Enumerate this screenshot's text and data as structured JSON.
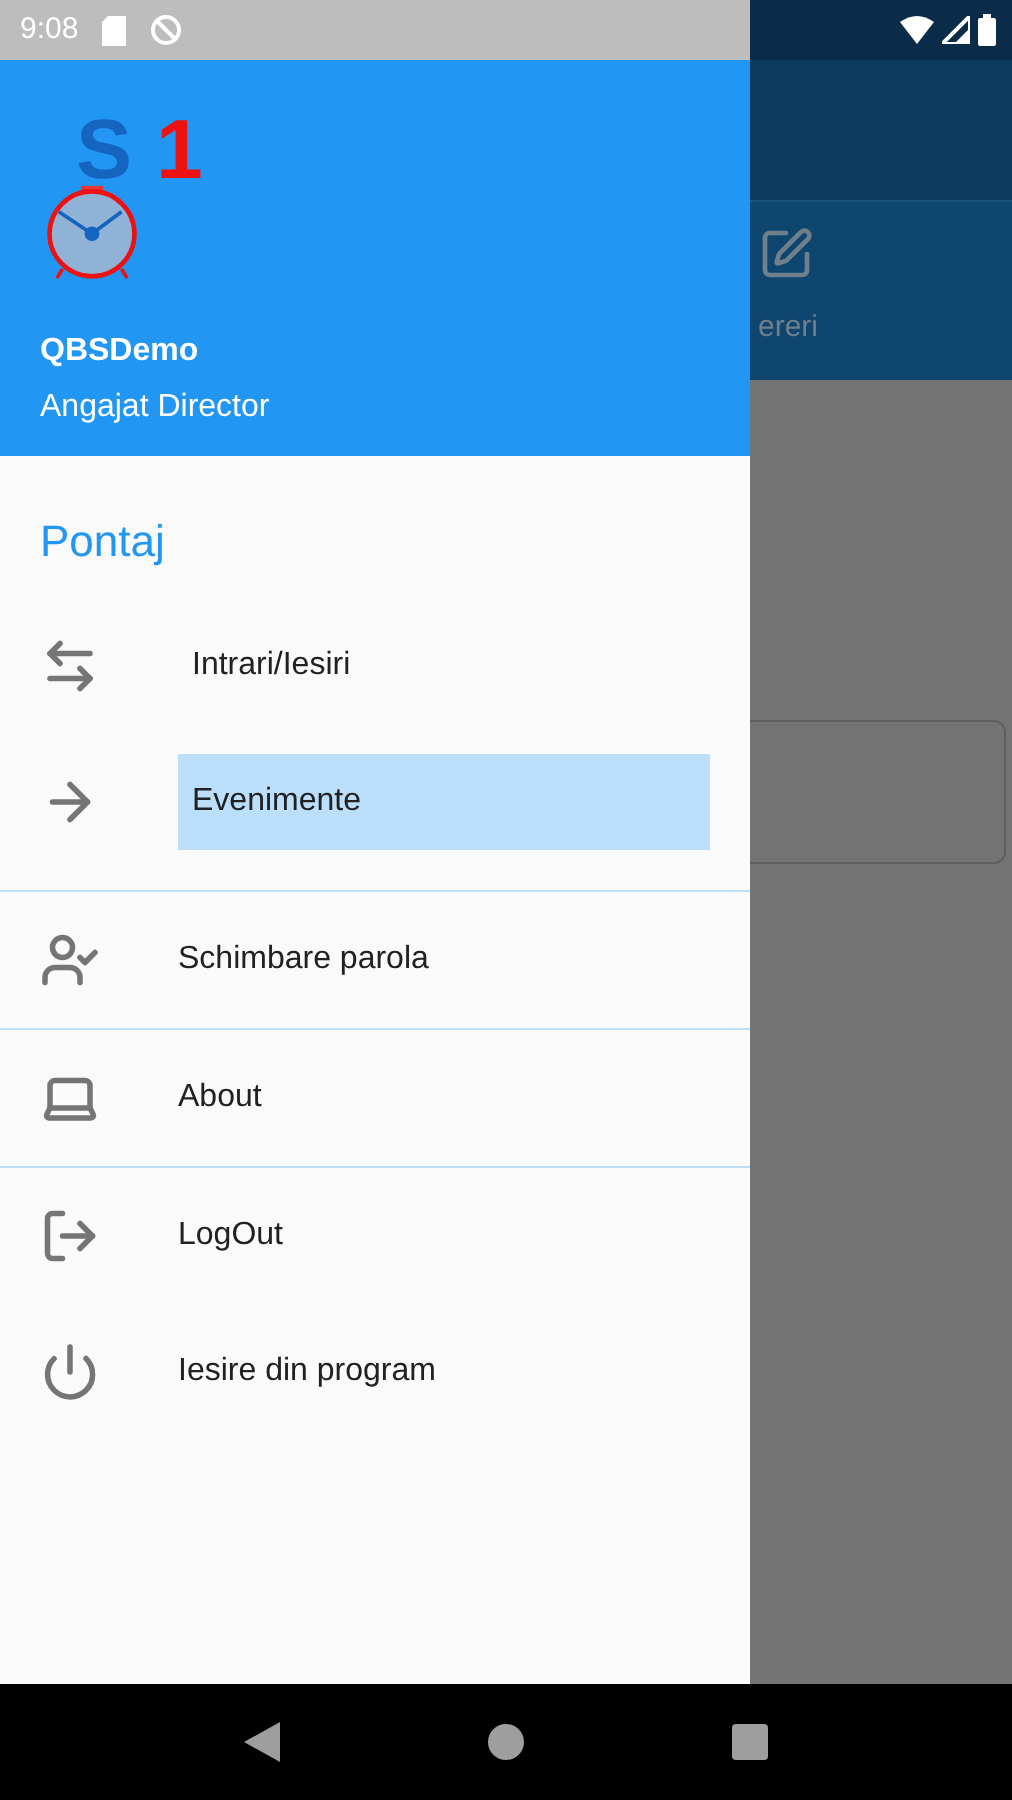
{
  "status_bar": {
    "time": "9:08"
  },
  "drawer": {
    "logo": {
      "letter": "S",
      "digit": "1"
    },
    "user_name": "QBSDemo",
    "user_role": "Angajat Director",
    "groups": [
      {
        "title": "Pontaj",
        "items": [
          {
            "label": "Intrari/Iesiri",
            "selected": false
          },
          {
            "label": "Evenimente",
            "selected": true
          }
        ]
      },
      {
        "items": [
          {
            "label": "Schimbare parola",
            "selected": false
          }
        ]
      },
      {
        "items": [
          {
            "label": "About",
            "selected": false
          }
        ]
      },
      {
        "items": [
          {
            "label": "LogOut",
            "selected": false
          },
          {
            "label": "Iesire din program",
            "selected": false
          }
        ]
      }
    ]
  },
  "background": {
    "tab_label": "ereri"
  }
}
